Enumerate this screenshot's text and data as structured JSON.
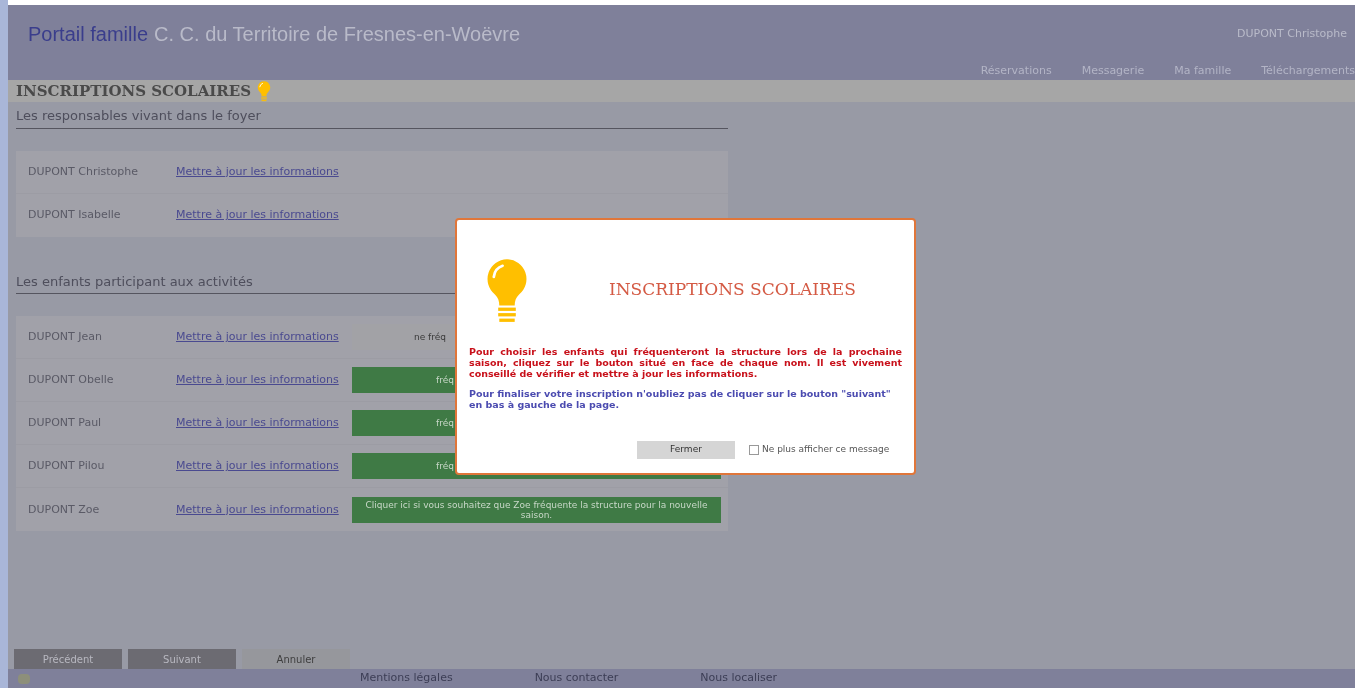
{
  "header": {
    "portal": "Portail famille",
    "organisation": "C. C. du Territoire de Fresnes-en-Woëvre",
    "user": "DUPONT Christophe",
    "nav": [
      "Réservations",
      "Messagerie",
      "Ma famille",
      "Téléchargements"
    ]
  },
  "page_title": "INSCRIPTIONS SCOLAIRES",
  "guardians": {
    "heading": "Les responsables vivant dans le foyer",
    "rows": [
      {
        "name": "DUPONT Christophe",
        "link": "Mettre à jour les informations"
      },
      {
        "name": "DUPONT Isabelle",
        "link": "Mettre à jour les informations"
      }
    ]
  },
  "children": {
    "heading": "Les enfants participant aux activités",
    "rows": [
      {
        "name": "DUPONT Jean",
        "link": "Mettre à jour les informations",
        "kind": "declined",
        "button": "ne fréq"
      },
      {
        "name": "DUPONT Obelle",
        "link": "Mettre à jour les informations",
        "kind": "enrolled",
        "button": "fréq"
      },
      {
        "name": "DUPONT Paul",
        "link": "Mettre à jour les informations",
        "kind": "enrolled",
        "button": "fréq"
      },
      {
        "name": "DUPONT Pilou",
        "link": "Mettre à jour les informations",
        "kind": "enrolled",
        "button": "fréq"
      },
      {
        "name": "DUPONT Zoe",
        "link": "Mettre à jour les informations",
        "kind": "enrolled",
        "button": "Cliquer ici si vous souhaitez que Zoe fréquente la structure pour la nouvelle saison."
      }
    ]
  },
  "actions": [
    "Précédent",
    "Suivant",
    "Annuler"
  ],
  "footer": [
    "Mentions légales",
    "Nous contacter",
    "Nous localiser"
  ],
  "modal": {
    "title": "INSCRIPTIONS SCOLAIRES",
    "warning": "Pour choisir les enfants qui fréquenteront la structure lors de la prochaine saison, cliquez sur le bouton situé en face de chaque nom. Il est vivement conseillé de vérifier et mettre à jour les informations.",
    "info": "Pour finaliser votre inscription n'oubliez pas de cliquer sur le bouton \"suivant\" en bas à gauche de la page.",
    "close": "Fermer",
    "dont_show": {
      "label": "Ne plus afficher ce message",
      "checked": false
    }
  }
}
